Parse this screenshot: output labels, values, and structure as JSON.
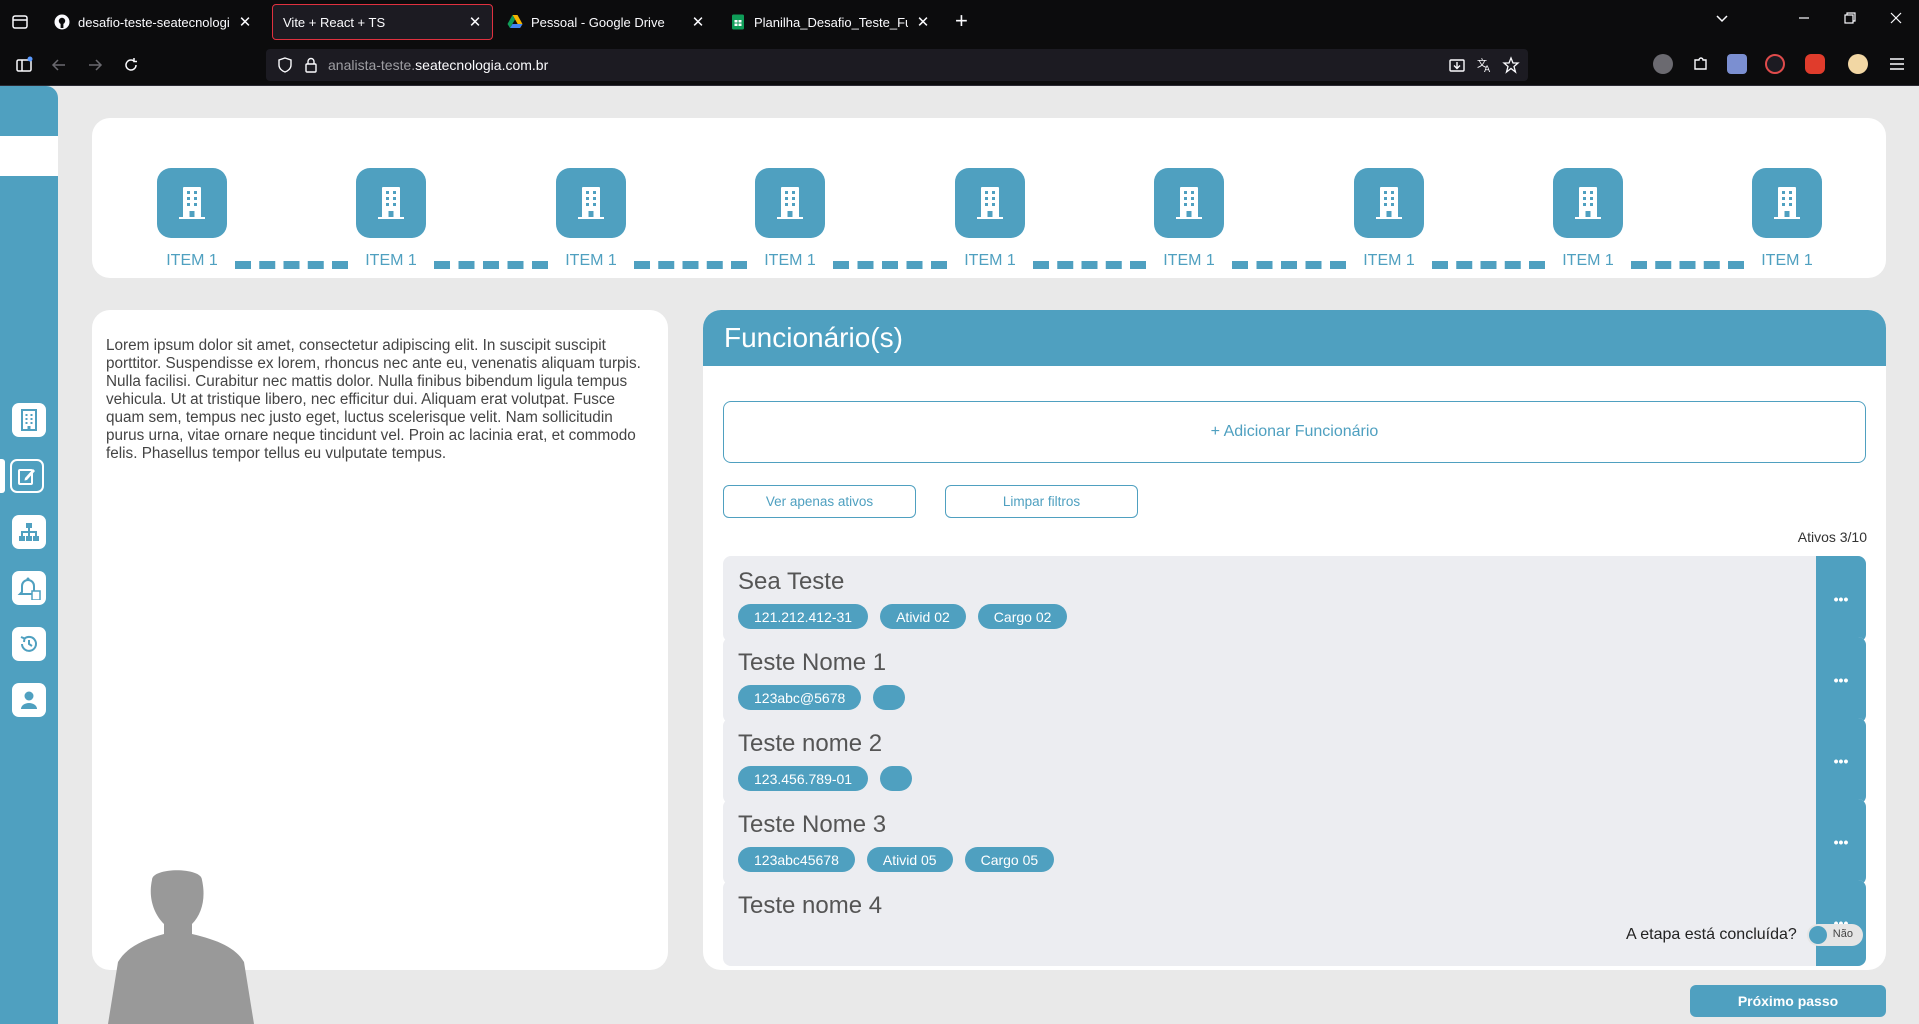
{
  "browser": {
    "tabs": [
      {
        "label": "desafio-teste-seatecnologia/rel",
        "favicon": "github-icon"
      },
      {
        "label": "Vite + React + TS",
        "favicon": "none"
      },
      {
        "label": "Pessoal - Google Drive",
        "favicon": "google-drive-icon"
      },
      {
        "label": "Planilha_Desafio_Teste_Funciona",
        "favicon": "google-sheets-icon"
      }
    ],
    "url_prefix": "analista-teste.",
    "url_domain": "seatecnologia.com.br"
  },
  "stepper": {
    "items": [
      {
        "label": "ITEM 1"
      },
      {
        "label": "ITEM 1"
      },
      {
        "label": "ITEM 1"
      },
      {
        "label": "ITEM 1"
      },
      {
        "label": "ITEM 1"
      },
      {
        "label": "ITEM 1"
      },
      {
        "label": "ITEM 1"
      },
      {
        "label": "ITEM 1"
      },
      {
        "label": "ITEM 1"
      }
    ],
    "icon": "building-icon"
  },
  "sidebar": {
    "icons": [
      "building-icon",
      "edit-icon",
      "org-chart-icon",
      "bell-document-icon",
      "history-icon",
      "user-icon"
    ],
    "active_index": 1
  },
  "description": "Lorem ipsum dolor sit amet, consectetur adipiscing elit. In suscipit suscipit porttitor. Suspendisse ex lorem, rhoncus nec ante eu, venenatis aliquam turpis. Nulla facilisi. Curabitur nec mattis dolor. Nulla finibus bibendum ligula tempus vehicula. Ut at tristique libero, nec efficitur dui. Aliquam erat volutpat. Fusce quam sem, tempus nec justo eget, luctus scelerisque velit. Nam sollicitudin purus urna, vitae ornare neque tincidunt vel. Proin ac lacinia erat, et commodo felis. Phasellus tempor tellus eu vulputate tempus.",
  "panel": {
    "title": "Funcionário(s)",
    "add_label": "+ Adicionar Funcionário",
    "filter_active_label": "Ver apenas ativos",
    "clear_filters_label": "Limpar filtros",
    "active_count": "Ativos 3/10",
    "menu_label": "•••",
    "employees": [
      {
        "name": "Sea Teste",
        "tags": [
          "121.212.412-31",
          "Ativid 02",
          "Cargo 02"
        ]
      },
      {
        "name": "Teste Nome 1",
        "tags": [
          "123abc@5678",
          ""
        ]
      },
      {
        "name": "Teste nome 2",
        "tags": [
          "123.456.789-01",
          ""
        ]
      },
      {
        "name": "Teste Nome 3",
        "tags": [
          "123abc45678",
          "Ativid 05",
          "Cargo 05"
        ]
      },
      {
        "name": "Teste nome 4",
        "tags": []
      }
    ]
  },
  "stage": {
    "question": "A etapa está concluída?",
    "toggle_label": "Não",
    "toggle_on": false
  },
  "next_button": "Próximo passo",
  "colors": {
    "accent": "#4fa0c0",
    "background": "#e9e9e9",
    "card": "#ffffff",
    "employee_row": "#ecedf1"
  }
}
